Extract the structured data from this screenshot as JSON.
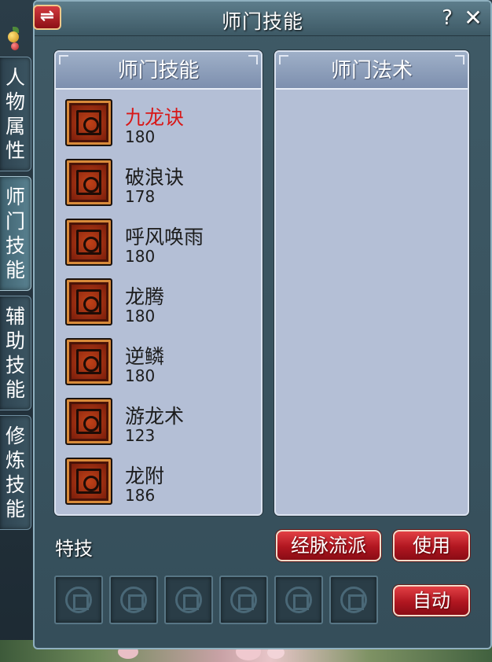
{
  "window": {
    "title": "师门技能",
    "swap_icon": "⇌",
    "help_label": "?",
    "close_label": "✕"
  },
  "side_tabs": [
    {
      "label": [
        "人",
        "物",
        "属",
        "性"
      ],
      "active": false
    },
    {
      "label": [
        "师",
        "门",
        "技",
        "能"
      ],
      "active": true
    },
    {
      "label": [
        "辅",
        "助",
        "技",
        "能"
      ],
      "active": false
    },
    {
      "label": [
        "修",
        "炼",
        "技",
        "能"
      ],
      "active": false
    }
  ],
  "left_panel": {
    "header": "师门技能",
    "skills": [
      {
        "name": "九龙诀",
        "level": "180",
        "selected": true,
        "icon": "dragon-spiral-icon"
      },
      {
        "name": "破浪诀",
        "level": "178",
        "selected": false,
        "icon": "wave-glyph-icon"
      },
      {
        "name": "呼风唤雨",
        "level": "180",
        "selected": false,
        "icon": "wind-rain-icon"
      },
      {
        "name": "龙腾",
        "level": "180",
        "selected": false,
        "icon": "dragon-soar-icon"
      },
      {
        "name": "逆鳞",
        "level": "180",
        "selected": false,
        "icon": "reverse-scale-icon"
      },
      {
        "name": "游龙术",
        "level": "123",
        "selected": false,
        "icon": "wandering-dragon-icon"
      },
      {
        "name": "龙附",
        "level": "186",
        "selected": false,
        "icon": "dragon-attach-icon"
      }
    ]
  },
  "right_panel": {
    "header": "师门法术"
  },
  "bottom": {
    "tech_label": "特技",
    "route_button": "经脉流派",
    "use_button": "使用",
    "auto_button": "自动",
    "slot_count": 6
  },
  "colors": {
    "accent_red": "#b01620",
    "selected_text": "#d81818",
    "panel_bg": "#b4bfd6"
  }
}
